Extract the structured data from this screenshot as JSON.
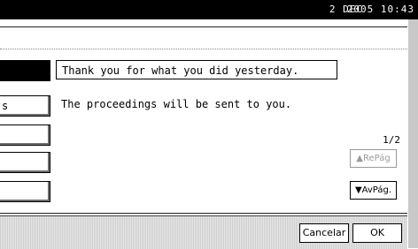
{
  "status_bar": {
    "date": "2 DEC",
    "time": "2005 10:43"
  },
  "rows": [
    {
      "left_label": "",
      "text": "Thank you for what you did yesterday.",
      "selected": true
    },
    {
      "left_label": "s",
      "text": "The proceedings will be sent to you.",
      "selected": false
    },
    {
      "left_label": "",
      "text": "",
      "selected": false
    },
    {
      "left_label": "",
      "text": "",
      "selected": false
    },
    {
      "left_label": "",
      "text": "",
      "selected": false
    }
  ],
  "paging": {
    "counter": "1/2",
    "prev_label": "▲RePág",
    "next_label": "▼AvPág."
  },
  "actions": {
    "cancel_label": "Cancelar",
    "ok_label": "OK"
  }
}
